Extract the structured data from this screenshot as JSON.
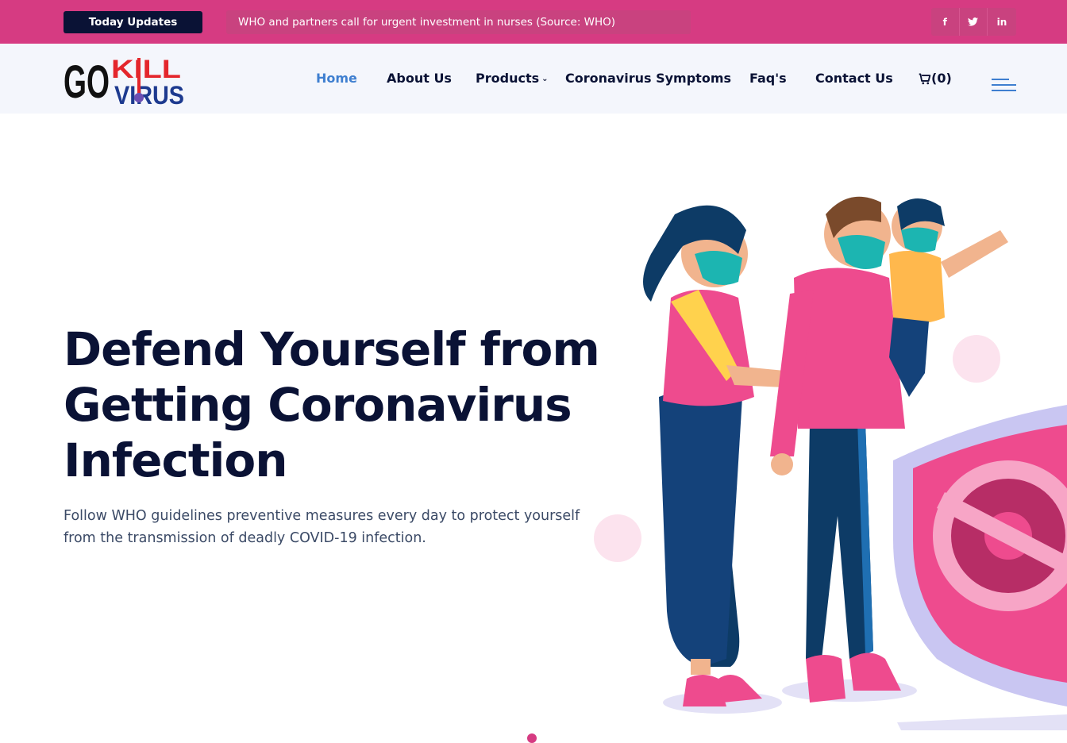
{
  "topbar": {
    "updates_label": "Today Updates",
    "ticker_text": "WHO and partners call for urgent investment in nurses (Source: WHO)",
    "socials": [
      {
        "icon": "facebook-icon",
        "glyph": "f"
      },
      {
        "icon": "twitter-icon",
        "glyph": "t"
      },
      {
        "icon": "linkedin-icon",
        "glyph": "in"
      }
    ]
  },
  "header": {
    "logo": {
      "go": "GO",
      "kill": "KILL",
      "virus": "VIRUS"
    },
    "nav": {
      "home": "Home",
      "about": "About Us",
      "products": "Products",
      "symptoms": "Coronavirus Symptoms",
      "faq": "Faq's",
      "contact": "Contact Us"
    },
    "cart_count": "(0)"
  },
  "hero": {
    "title_line1": "Defend Yourself from",
    "title_line2": "Getting Coronavirus",
    "title_line3": "Infection",
    "text_line1": "Follow WHO guidelines preventive measures every day to protect yourself",
    "text_line2": "from the transmission of deadly COVID-19 infection."
  },
  "colors": {
    "topbar": "#d63b82",
    "navy": "#0a1235",
    "accent_blue": "#3f7fd0",
    "pink": "#ee4b8e"
  }
}
